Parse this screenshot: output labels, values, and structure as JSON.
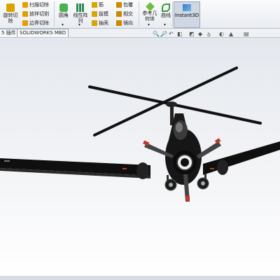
{
  "ribbon": {
    "revolve_cut": "旋转切\n除",
    "sweep_cut": "扫描切除",
    "loft_cut": "放样切割",
    "boundary_cut": "边界切除",
    "fillet": "圆角",
    "linear_pattern": "线性阵\n列",
    "rib": "筋",
    "draft": "拔模",
    "shell": "抽壳",
    "wrap": "包覆",
    "intersect": "相交",
    "mirror": "镜向",
    "ref_geometry": "参考几\n何体",
    "curves": "曲线",
    "instant3d": "Instant3D"
  },
  "tabs": {
    "plugins": "5 插件",
    "mbd": "SOLIDWORKS MBD"
  },
  "colors": {
    "accent": "#cfd7e2",
    "viewport_top": "#e4e8ee",
    "model_black": "#111111",
    "prop_red": "#c0392b"
  }
}
